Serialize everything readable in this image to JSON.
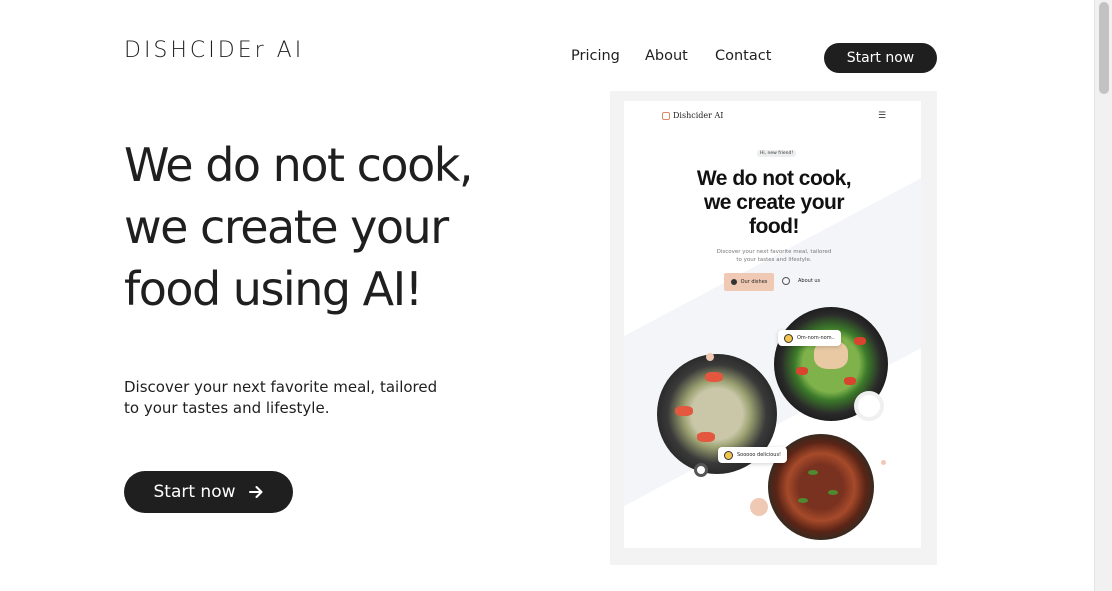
{
  "header": {
    "logo": "DISHCIDEr AI",
    "nav": [
      {
        "label": "Pricing"
      },
      {
        "label": "About"
      },
      {
        "label": "Contact"
      }
    ],
    "cta_label": "Start now"
  },
  "hero": {
    "title_lines": [
      "We do not cook,",
      "we create your",
      "food using AI!"
    ],
    "subtitle_lines": [
      "Discover your next favorite meal, tailored",
      "to your tastes and lifestyle."
    ],
    "cta_label": "Start now",
    "cta_icon": "arrow-right-icon"
  },
  "preview": {
    "logo": "Dishcider AI",
    "menu_icon": "hamburger-menu-icon",
    "badge": "Hi, new friend!",
    "title_lines": [
      "We do not cook,",
      "we create your",
      "food!"
    ],
    "subtitle_lines": [
      "Discover your next favorite meal, tailored",
      "to your tastes and lifestyle."
    ],
    "primary_button": "Our dishes",
    "secondary_link": "About us",
    "bubble_1": "Om-nom-nom..",
    "bubble_2": "Sooooo delicious!"
  },
  "colors": {
    "dark": "#1f1f1f",
    "accent_peach": "#f0c9b4",
    "background": "#ffffff"
  }
}
